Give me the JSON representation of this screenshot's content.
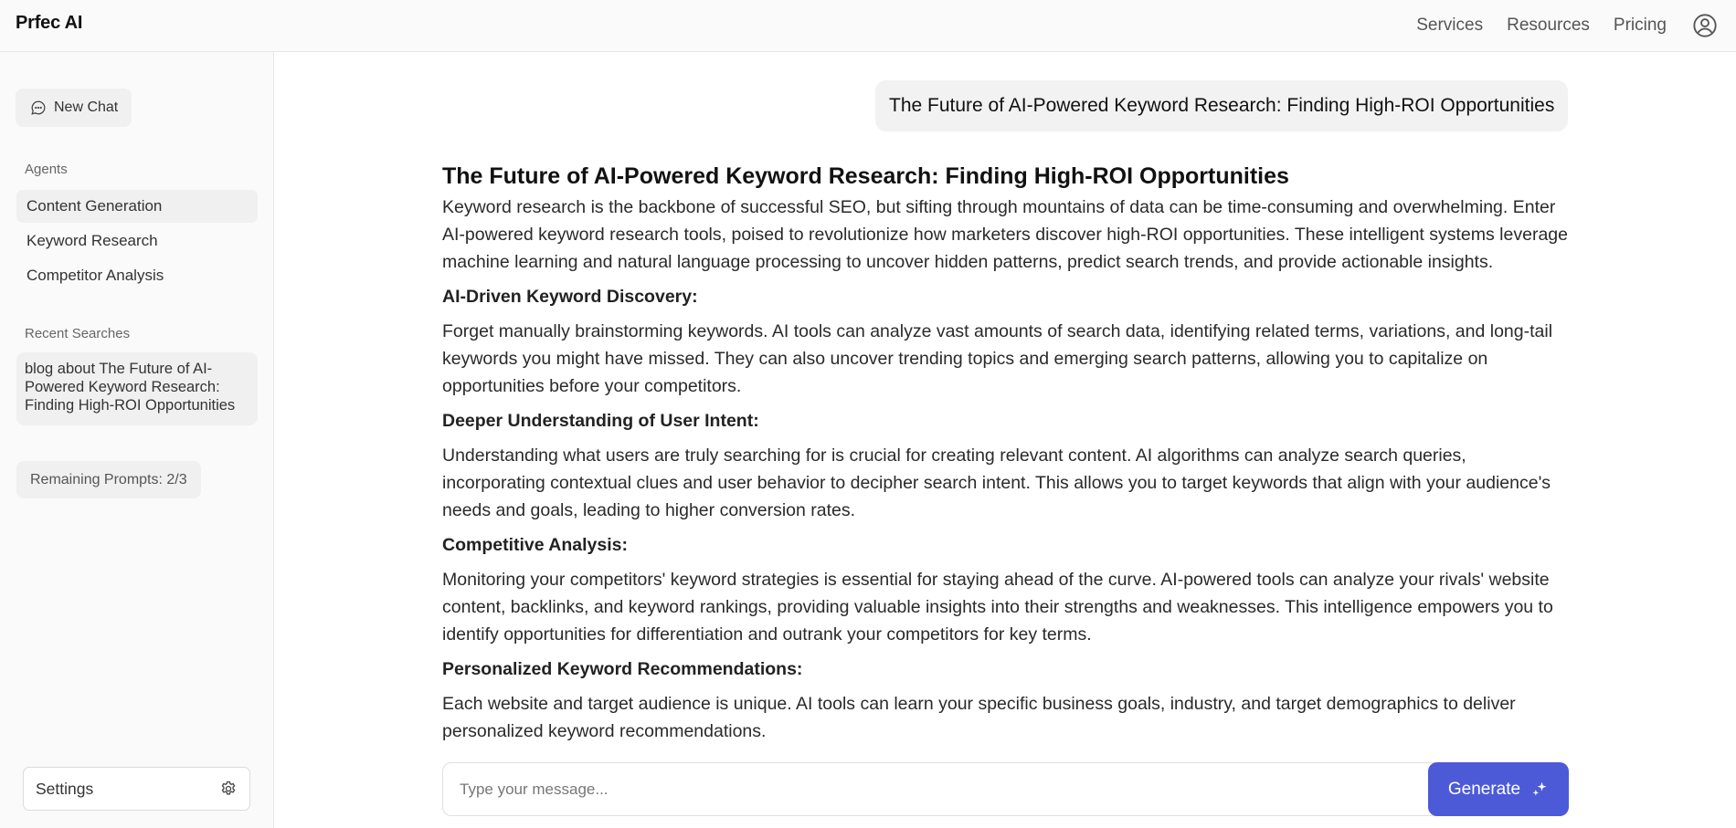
{
  "header": {
    "logo": "Prfec AI",
    "nav": [
      "Services",
      "Resources",
      "Pricing"
    ],
    "user_icon": "user-circle-icon"
  },
  "sidebar": {
    "new_chat_label": "New Chat",
    "new_chat_icon": "chat-bubble-icon",
    "agents_heading": "Agents",
    "agents": [
      "Content Generation",
      "Keyword Research",
      "Competitor Analysis"
    ],
    "active_agent": "Content Generation",
    "recent_heading": "Recent Searches",
    "recent_items": [
      "blog about The Future of AI-Powered Keyword Research: Finding High-ROI Opportunities"
    ],
    "remaining_prompts": "Remaining Prompts: 2/3",
    "settings_label": "Settings",
    "settings_icon": "gear-icon"
  },
  "chat": {
    "user_message": "The Future of AI-Powered Keyword Research: Finding High-ROI Opportunities",
    "response": {
      "title": "The Future of AI-Powered Keyword Research: Finding High-ROI Opportunities",
      "intro": "Keyword research is the backbone of successful SEO, but sifting through mountains of data can be time-consuming and overwhelming. Enter AI-powered keyword research tools, poised to revolutionize how marketers discover high-ROI opportunities. These intelligent systems leverage machine learning and natural language processing to uncover hidden patterns, predict search trends, and provide actionable insights.",
      "sections": [
        {
          "heading": "AI-Driven Keyword Discovery:",
          "body": "Forget manually brainstorming keywords. AI tools can analyze vast amounts of search data, identifying related terms, variations, and long-tail keywords you might have missed. They can also uncover trending topics and emerging search patterns, allowing you to capitalize on opportunities before your competitors."
        },
        {
          "heading": "Deeper Understanding of User Intent:",
          "body": "Understanding what users are truly searching for is crucial for creating relevant content. AI algorithms can analyze search queries, incorporating contextual clues and user behavior to decipher search intent. This allows you to target keywords that align with your audience's needs and goals, leading to higher conversion rates."
        },
        {
          "heading": "Competitive Analysis:",
          "body": "Monitoring your competitors' keyword strategies is essential for staying ahead of the curve. AI-powered tools can analyze your rivals' website content, backlinks, and keyword rankings, providing valuable insights into their strengths and weaknesses. This intelligence empowers you to identify opportunities for differentiation and outrank your competitors for key terms."
        },
        {
          "heading": "Personalized Keyword Recommendations:",
          "body": "Each website and target audience is unique. AI tools can learn your specific business goals, industry, and target demographics to deliver personalized keyword recommendations."
        }
      ]
    }
  },
  "composer": {
    "placeholder": "Type your message...",
    "value": "",
    "generate_label": "Generate",
    "generate_icon": "sparkle-icon"
  },
  "colors": {
    "accent": "#4c5ad8",
    "sidebar_bg": "#fafafa",
    "chip_bg": "#f0f0f0"
  }
}
